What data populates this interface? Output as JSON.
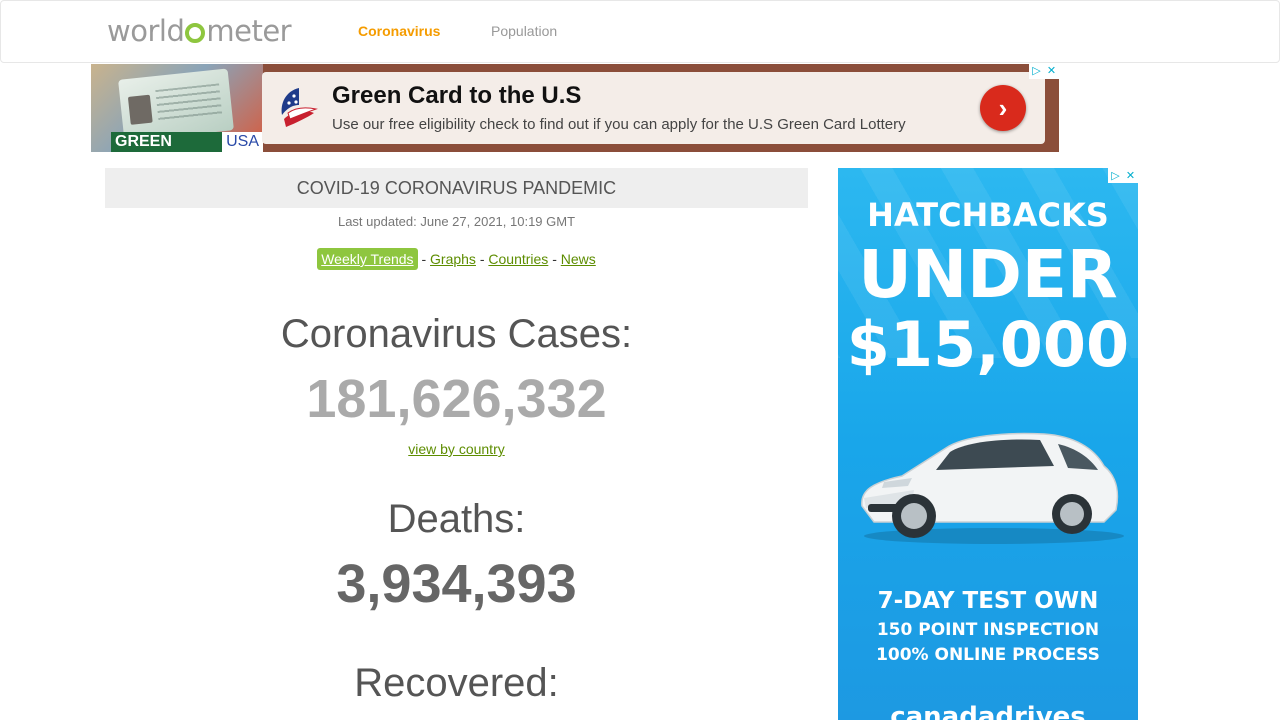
{
  "nav": {
    "logo_pre": "world",
    "logo_post": "meter",
    "links": [
      {
        "label": "Coronavirus",
        "active": true
      },
      {
        "label": "Population",
        "active": false
      }
    ]
  },
  "top_ad": {
    "badge_left": "GREEN CARD",
    "badge_right": "USA",
    "title": "Green Card to the U.S",
    "subtitle": "Use our free eligibility check to find out if you can apply for the U.S Green Card Lottery",
    "button_icon": "chevron-right-icon",
    "adchoices_icon": "▷",
    "close_icon": "✕"
  },
  "main": {
    "header": "COVID-19 CORONAVIRUS PANDEMIC",
    "last_updated": "Last updated: June 27, 2021, 10:19 GMT",
    "links": [
      "Weekly Trends",
      "Graphs",
      "Countries",
      "News"
    ],
    "separator": "-",
    "cases_label": "Coronavirus Cases:",
    "cases_value": "181,626,332",
    "view_by_country": "view by country",
    "deaths_label": "Deaths:",
    "deaths_value": "3,934,393",
    "recovered_label": "Recovered:"
  },
  "side_ad": {
    "line1": "HATCHBACKS",
    "line2": "UNDER",
    "line3": "$15,000",
    "tag1": "7-DAY TEST OWN",
    "tag2": "150 POINT INSPECTION",
    "tag3": "100% ONLINE PROCESS",
    "brand": "canadadrives",
    "adchoices_icon": "▷",
    "close_icon": "✕"
  },
  "colors": {
    "logo_green": "#8ec63f",
    "nav_active": "#f59c00",
    "link_green": "#5d8d00",
    "ad_blue": "#19a6ea",
    "ad_button_red": "#d92a1c"
  }
}
